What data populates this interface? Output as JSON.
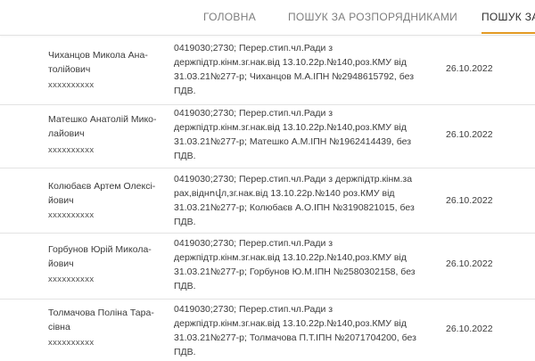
{
  "nav": {
    "tabs": [
      {
        "label": "ГОЛОВНА"
      },
      {
        "label": "ПОШУК ЗА РОЗПОРЯДНИКАМИ"
      },
      {
        "label": "ПОШУК ЗА"
      }
    ],
    "active_index": 2,
    "accent_color": "#e39a24"
  },
  "rows": [
    {
      "name_lines": [
        "Чиханцов Микола Ана-",
        "толійович"
      ],
      "code": "xxxxxxxxxx",
      "purpose_lines": [
        "0419030;2730; Перер.стип.чл.Ради з",
        "держпідтр.кінм.зг.нак.від 13.10.22р.№140,роз.КМУ від",
        "31.03.21№277-р; Чиханцов М.А.ІПН №2948615792, без",
        "ПДВ."
      ],
      "date": "26.10.2022"
    },
    {
      "name_lines": [
        "Матешко Анатолій Мико-",
        "лайович"
      ],
      "code": "xxxxxxxxxx",
      "purpose_lines": [
        "0419030;2730; Перер.стип.чл.Ради з",
        "держпідтр.кінм.зг.нак.від 13.10.22р.№140,роз.КМУ від",
        "31.03.21№277-р; Матешко А.М.ІПН №1962414439, без",
        "ПДВ."
      ],
      "date": "26.10.2022"
    },
    {
      "name_lines": [
        "Колюбаєв Артем Олексі-",
        "йович"
      ],
      "code": "xxxxxxxxxx",
      "purpose_lines": [
        "0419030;2730; Перер.стип.чл.Ради з держпідтр.кінм.за",
        "рах,віднովл,зг.нак.від 13.10.22р.№140 роз.КМУ від",
        "31.03.21№277-р; Колюбаєв А.О.ІПН №3190821015, без",
        "ПДВ."
      ],
      "date": "26.10.2022"
    },
    {
      "name_lines": [
        "Горбунов Юрій Микола-",
        "йович"
      ],
      "code": "xxxxxxxxxx",
      "purpose_lines": [
        "0419030;2730; Перер.стип.чл.Ради з",
        "держпідтр.кінм.зг.нак.від 13.10.22р.№140,роз.КМУ від",
        "31.03.21№277-р; Горбунов Ю.М.ІПН №2580302158, без",
        "ПДВ."
      ],
      "date": "26.10.2022"
    },
    {
      "name_lines": [
        "Толмачова Поліна Тара-",
        "сівна"
      ],
      "code": "xxxxxxxxxx",
      "purpose_lines": [
        "0419030;2730; Перер.стип.чл.Ради з",
        "держпідтр.кінм.зг.нак.від 13.10.22р.№140,роз.КМУ від",
        "31.03.21№277-р; Толмачова П.Т.ІПН №2071704200, без",
        "ПДВ."
      ],
      "date": "26.10.2022"
    }
  ]
}
